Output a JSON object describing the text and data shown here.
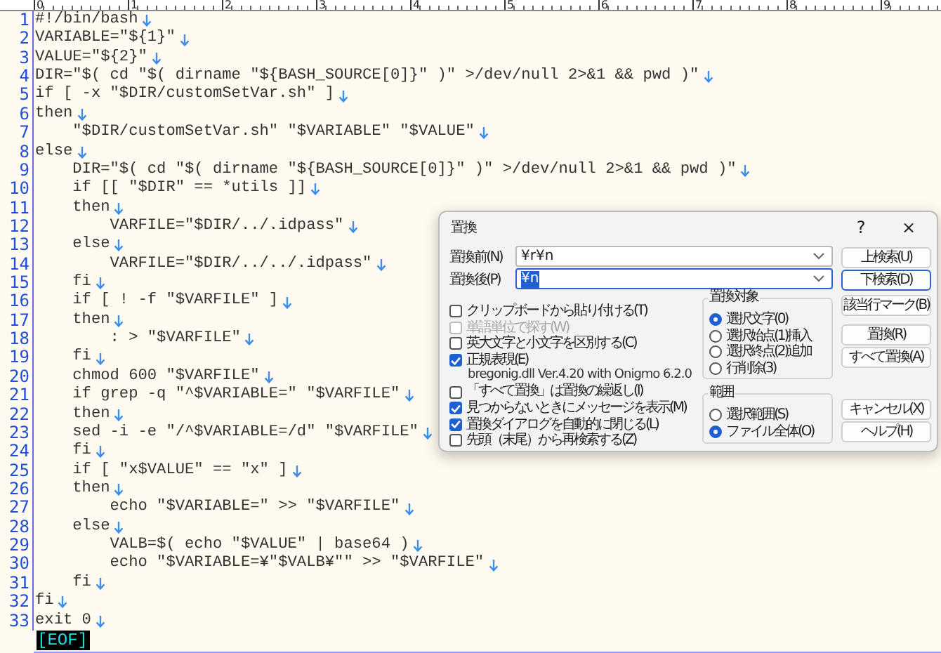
{
  "ruler": {
    "marks": [
      "0",
      "1",
      "2",
      "3",
      "4",
      "5",
      "6",
      "7",
      "8",
      "9"
    ]
  },
  "editor": {
    "lines": [
      {
        "number": "1",
        "text": "#!/bin/bash",
        "eol": true
      },
      {
        "number": "2",
        "text": "VARIABLE=\"${1}\"",
        "eol": true
      },
      {
        "number": "3",
        "text": "VALUE=\"${2}\"",
        "eol": true
      },
      {
        "number": "4",
        "text": "DIR=\"$( cd \"$( dirname \"${BASH_SOURCE[0]}\" )\" >/dev/null 2>&1 && pwd )\"",
        "eol": true
      },
      {
        "number": "5",
        "text": "if [ -x \"$DIR/customSetVar.sh\" ]",
        "eol": true
      },
      {
        "number": "6",
        "text": "then",
        "eol": true
      },
      {
        "number": "7",
        "text": "    \"$DIR/customSetVar.sh\" \"$VARIABLE\" \"$VALUE\"",
        "eol": true
      },
      {
        "number": "8",
        "text": "else",
        "eol": true
      },
      {
        "number": "9",
        "text": "    DIR=\"$( cd \"$( dirname \"${BASH_SOURCE[0]}\" )\" >/dev/null 2>&1 && pwd )\"",
        "eol": true
      },
      {
        "number": "10",
        "text": "    if [[ \"$DIR\" == *utils ]]",
        "eol": true
      },
      {
        "number": "11",
        "text": "    then",
        "eol": true
      },
      {
        "number": "12",
        "text": "        VARFILE=\"$DIR/../.idpass\"",
        "eol": true
      },
      {
        "number": "13",
        "text": "    else",
        "eol": true
      },
      {
        "number": "14",
        "text": "        VARFILE=\"$DIR/../../.idpass\"",
        "eol": true
      },
      {
        "number": "15",
        "text": "    fi",
        "eol": true
      },
      {
        "number": "16",
        "text": "    if [ ! -f \"$VARFILE\" ]",
        "eol": true
      },
      {
        "number": "17",
        "text": "    then",
        "eol": true
      },
      {
        "number": "18",
        "text": "        : > \"$VARFILE\"",
        "eol": true
      },
      {
        "number": "19",
        "text": "    fi",
        "eol": true
      },
      {
        "number": "20",
        "text": "    chmod 600 \"$VARFILE\"",
        "eol": true
      },
      {
        "number": "21",
        "text": "    if grep -q \"^$VARIABLE=\" \"$VARFILE\"",
        "eol": true
      },
      {
        "number": "22",
        "text": "    then",
        "eol": true
      },
      {
        "number": "23",
        "text": "    sed -i -e \"/^$VARIABLE=/d\" \"$VARFILE\"",
        "eol": true
      },
      {
        "number": "24",
        "text": "    fi",
        "eol": true
      },
      {
        "number": "25",
        "text": "    if [ \"x$VALUE\" == \"x\" ]",
        "eol": true
      },
      {
        "number": "26",
        "text": "    then",
        "eol": true
      },
      {
        "number": "27",
        "text": "        echo \"$VARIABLE=\" >> \"$VARFILE\"",
        "eol": true
      },
      {
        "number": "28",
        "text": "    else",
        "eol": true
      },
      {
        "number": "29",
        "text": "        VALB=$( echo \"$VALUE\" | base64 )",
        "eol": true
      },
      {
        "number": "30",
        "text": "        echo \"$VARIABLE=¥\"$VALB¥\"\" >> \"$VARFILE\"",
        "eol": true
      },
      {
        "number": "31",
        "text": "    fi",
        "eol": true
      },
      {
        "number": "32",
        "text": "fi",
        "eol": true
      },
      {
        "number": "33",
        "text": "exit 0",
        "eol": true
      }
    ],
    "eof": "[EOF]"
  },
  "dialog": {
    "title": "置換",
    "help_glyph": "?",
    "close_glyph": "×",
    "fields": [
      {
        "label": "置換前(N)",
        "value": "¥r¥n",
        "highlighted": false,
        "focused": false
      },
      {
        "label": "置換後(P)",
        "value": "¥n",
        "highlighted": true,
        "focused": true
      }
    ],
    "options": [
      {
        "kind": "checkbox",
        "label": "クリップボードから貼り付ける(T)",
        "checked": false,
        "disabled": false
      },
      {
        "kind": "checkbox",
        "label": "単語単位で探す(W)",
        "checked": false,
        "disabled": true
      },
      {
        "kind": "checkbox",
        "label": "英大文字と小文字を区別する(C)",
        "checked": false,
        "disabled": false
      },
      {
        "kind": "checkbox",
        "label": "正規表現(E)",
        "checked": true,
        "disabled": false
      },
      {
        "kind": "note",
        "label": "bregonig.dll Ver.4.20 with Onigmo 6.2.0"
      },
      {
        "kind": "checkbox",
        "label": "「すべて置換」は置換の繰返し(I)",
        "checked": false,
        "disabled": false
      },
      {
        "kind": "checkbox",
        "label": "見つからないときにメッセージを表示(M)",
        "checked": true,
        "disabled": false
      },
      {
        "kind": "checkbox",
        "label": "置換ダイアログを自動的に閉じる(L)",
        "checked": true,
        "disabled": false
      },
      {
        "kind": "checkbox",
        "label": "先頭（末尾）から再検索する(Z)",
        "checked": false,
        "disabled": false
      }
    ],
    "groups": [
      {
        "title": "置換対象",
        "radios": [
          {
            "label": "選択文字(0)",
            "selected": true
          },
          {
            "label": "選択始点(1)挿入",
            "selected": false
          },
          {
            "label": "選択終点(2)追加",
            "selected": false
          },
          {
            "label": "行削除(3)",
            "selected": false
          }
        ]
      },
      {
        "title": "範囲",
        "radios": [
          {
            "label": "選択範囲(S)",
            "selected": false
          },
          {
            "label": "ファイル全体(O)",
            "selected": true
          }
        ]
      }
    ],
    "buttons": [
      {
        "label": "上検索(U)",
        "default": false
      },
      {
        "label": "下検索(D)",
        "default": true
      },
      {
        "label": "該当行マーク(B)",
        "default": false
      },
      {
        "label": "置換(R)",
        "default": false
      },
      {
        "label": "すべて置換(A)",
        "default": false
      },
      {
        "label": "キャンセル(X)",
        "default": false
      },
      {
        "label": "ヘルプ(H)",
        "default": false
      }
    ]
  }
}
